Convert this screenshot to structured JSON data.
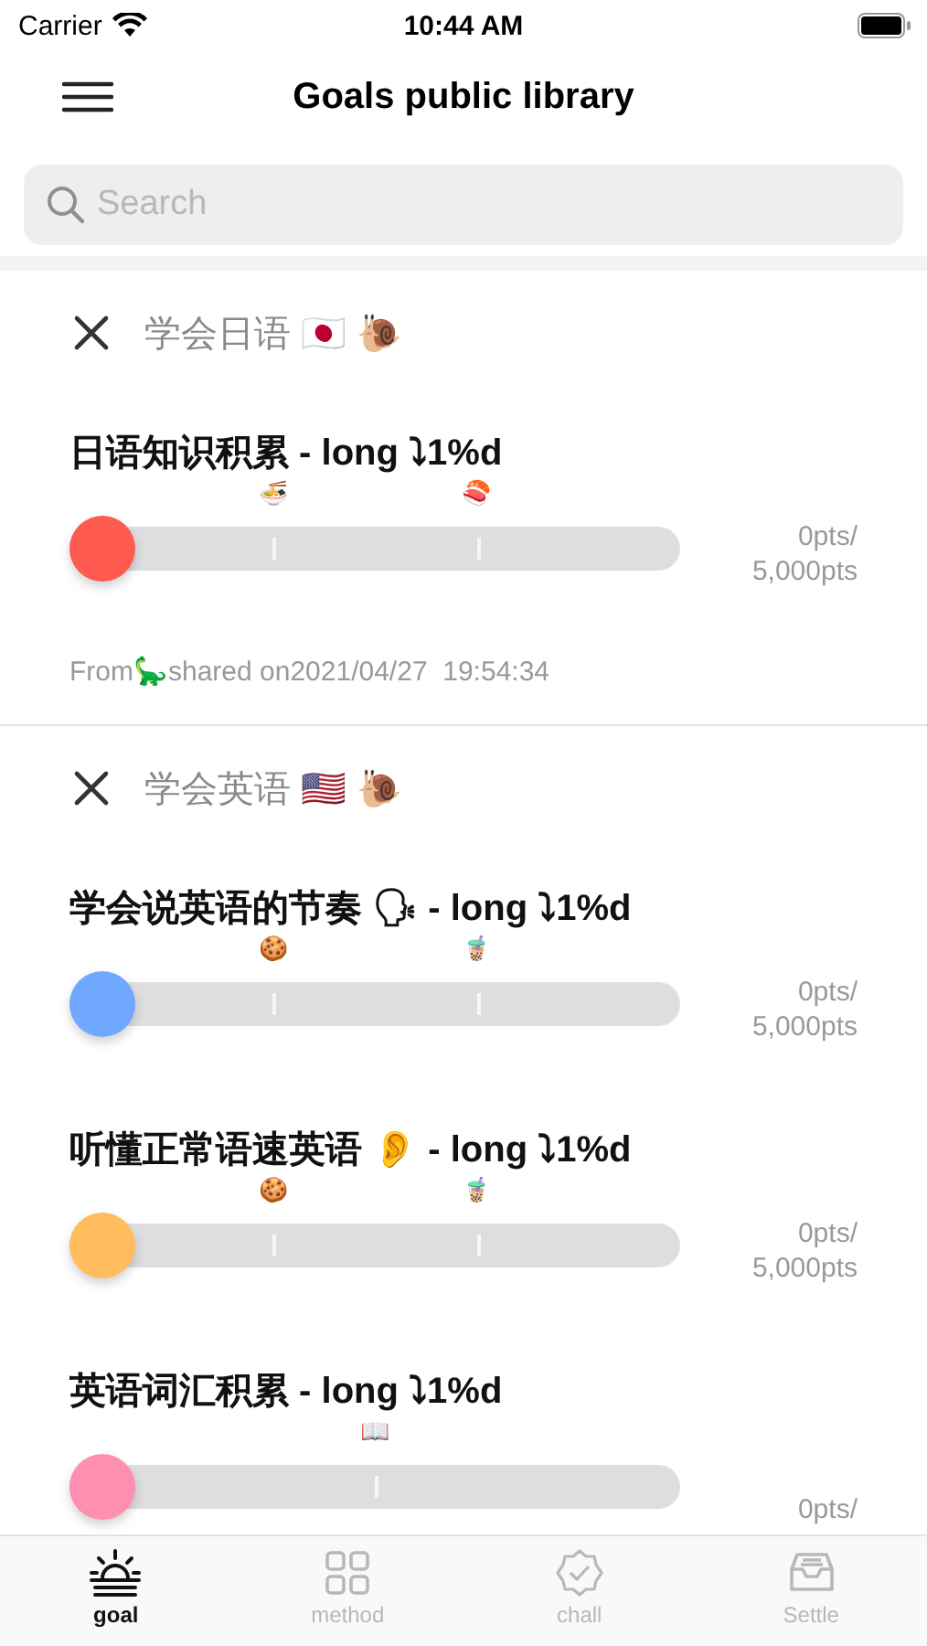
{
  "status_bar": {
    "carrier": "Carrier",
    "time": "10:44 AM"
  },
  "nav": {
    "title": "Goals public library"
  },
  "search": {
    "placeholder": "Search"
  },
  "groups": [
    {
      "title": "学会日语 🇯🇵 🐌",
      "goals": [
        {
          "title": "日语知识积累 - long ⤵1%d",
          "color": "#ff5a50",
          "level": 0,
          "milestones": [
            "🍜",
            "🍣"
          ],
          "points": "0pts/",
          "total": "5,000pts"
        }
      ],
      "footer": "From🦕shared on2021/04/27  19:54:34"
    },
    {
      "title": "学会英语 🇺🇸 🐌",
      "goals": [
        {
          "title": "学会说英语的节奏 🗣 - long ⤵1%d",
          "color": "#70a8ff",
          "level": 0,
          "milestones": [
            "🍪",
            "🧋"
          ],
          "points": "0pts/",
          "total": "5,000pts"
        },
        {
          "title": "听懂正常语速英语 👂 - long ⤵1%d",
          "color": "#ffbd5e",
          "level": 0,
          "milestones": [
            "🍪",
            "🧋"
          ],
          "points": "0pts/",
          "total": "5,000pts"
        },
        {
          "title": "英语词汇积累 - long ⤵1%d",
          "color": "#ff8fb0",
          "level": 0,
          "milestones": [
            "📖"
          ],
          "points": "0pts/"
        }
      ]
    }
  ],
  "tabs": [
    {
      "label": "goal",
      "selected": true
    },
    {
      "label": "method",
      "selected": false
    },
    {
      "label": "chall",
      "selected": false
    },
    {
      "label": "Settle",
      "selected": false
    }
  ]
}
